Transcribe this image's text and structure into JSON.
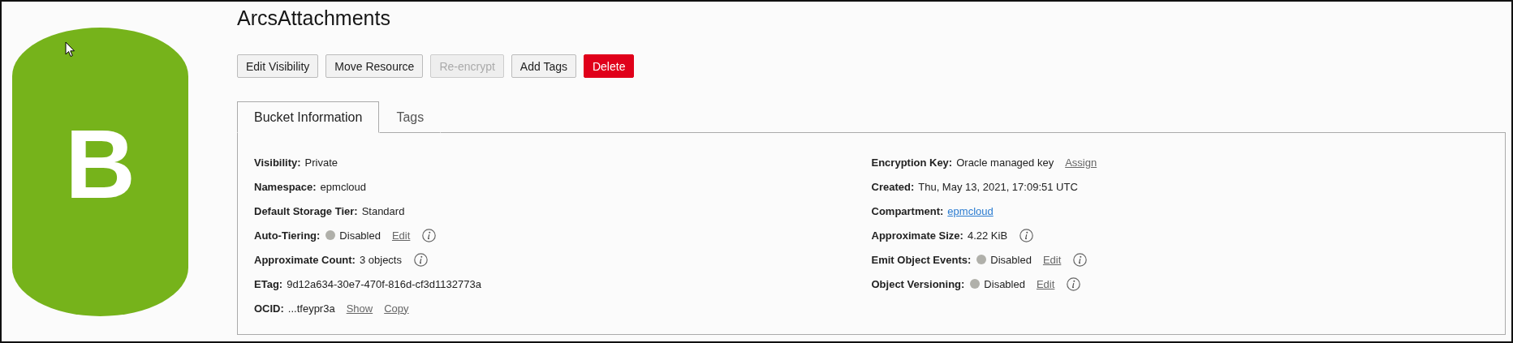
{
  "bucket_icon": {
    "letter": "B"
  },
  "title": "ArcsAttachments",
  "buttons": [
    {
      "label": "Edit Visibility",
      "kind": "default",
      "disabled": false
    },
    {
      "label": "Move Resource",
      "kind": "default",
      "disabled": false
    },
    {
      "label": "Re-encrypt",
      "kind": "default",
      "disabled": true
    },
    {
      "label": "Add Tags",
      "kind": "default",
      "disabled": false
    },
    {
      "label": "Delete",
      "kind": "danger",
      "disabled": false
    }
  ],
  "tabs": [
    {
      "label": "Bucket Information",
      "selected": true
    },
    {
      "label": "Tags",
      "selected": false
    }
  ],
  "details_left": [
    {
      "label": "Visibility:",
      "value": "Private",
      "value_link": false,
      "info": false
    },
    {
      "label": "Namespace:",
      "value": "epmcloud",
      "value_link": false,
      "info": false
    },
    {
      "label": "Default Storage Tier:",
      "value": "Standard",
      "value_link": false,
      "info": false
    },
    {
      "label": "Auto-Tiering:",
      "value": "Disabled",
      "value_link": false,
      "status_enabled": false,
      "actions": [
        "Edit"
      ],
      "info": true
    },
    {
      "label": "Approximate Count:",
      "value": "3 objects",
      "value_link": false,
      "info": true
    },
    {
      "label": "ETag:",
      "value": "9d12a634-30e7-470f-816d-cf3d1132773a",
      "value_link": false,
      "info": false
    },
    {
      "label": "OCID:",
      "value": "...tfeypr3a",
      "value_link": false,
      "actions": [
        "Show",
        "Copy"
      ],
      "info": false
    }
  ],
  "details_right": [
    {
      "label": "Encryption Key:",
      "value": "Oracle managed key",
      "value_link": false,
      "actions": [
        "Assign"
      ],
      "info": false
    },
    {
      "label": "Created:",
      "value": "Thu, May 13, 2021, 17:09:51 UTC",
      "value_link": false,
      "info": false
    },
    {
      "label": "Compartment:",
      "value": "epmcloud",
      "value_link": true,
      "info": false
    },
    {
      "label": "Approximate Size:",
      "value": "4.22 KiB",
      "value_link": false,
      "info": true
    },
    {
      "label": "Emit Object Events:",
      "value": "Disabled",
      "value_link": false,
      "status_enabled": false,
      "actions": [
        "Edit"
      ],
      "info": true
    },
    {
      "label": "Object Versioning:",
      "value": "Disabled",
      "value_link": false,
      "status_enabled": false,
      "actions": [
        "Edit"
      ],
      "info": true
    }
  ]
}
